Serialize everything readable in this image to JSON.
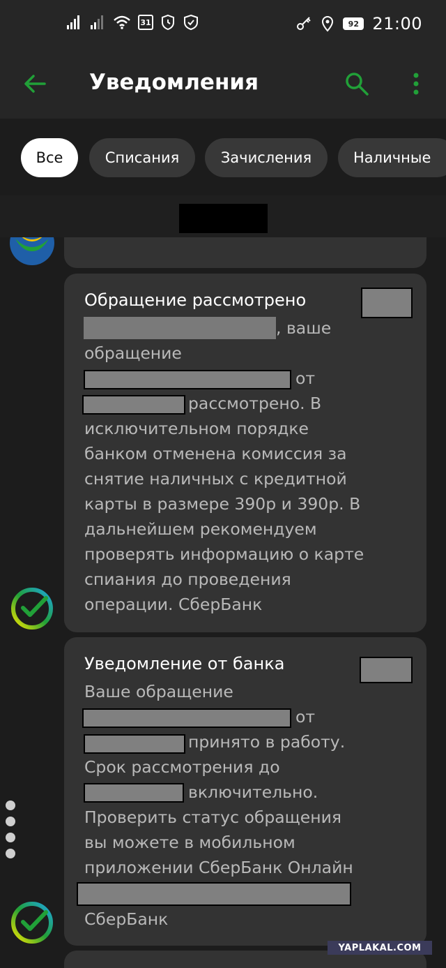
{
  "status_bar": {
    "time": "21:00",
    "battery": "92",
    "calendar_day": "31"
  },
  "app_bar": {
    "title": "Уведомления"
  },
  "filters": {
    "chips": [
      {
        "label": "Все",
        "active": true
      },
      {
        "label": "Списания",
        "active": false
      },
      {
        "label": "Зачисления",
        "active": false
      },
      {
        "label": "Наличные",
        "active": false
      }
    ]
  },
  "notifications": [
    {
      "title": "Обращение рассмотрено",
      "text_line_1": ", ваше",
      "text_line_2": "обращение",
      "text_line_3": "от",
      "text_line_4": "рассмотрено. В",
      "text_rest": "исключительном порядке\nбанком отменена комиссия за\nснятие наличных с кредитной\nкарты в размере 390р и 390р. В\nдальнейшем рекомендуем\nпроверять информацию о карте\nспиания до проведения\nоперации. СберБанк"
    },
    {
      "title": "Уведомление от банка",
      "text_line_1": "Ваше обращение",
      "text_line_2": "от",
      "text_line_3": "принято в работу.",
      "text_line_4": "Срок рассмотрения до",
      "text_line_5": "включительно.",
      "text_rest": "Проверить статус обращения\nвы можете в мобильном\nприложении СберБанк Онлайн",
      "text_last": "СберБанк"
    }
  ],
  "watermark": "YAPLAKAL.COM",
  "colors": {
    "accent_green": "#21a038",
    "background": "#1c1c1c",
    "card": "#333333"
  }
}
